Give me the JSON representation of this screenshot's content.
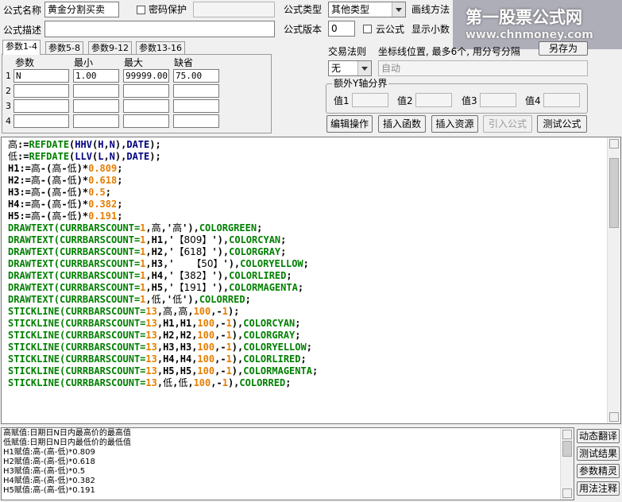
{
  "header": {
    "name_label": "公式名称",
    "name_value": "黄金分割买卖",
    "password_label": "密码保护",
    "desc_label": "公式描述",
    "desc_value": "",
    "type_label": "公式类型",
    "type_value": "其他类型",
    "draw_label": "画线方法",
    "version_label": "公式版本",
    "version_value": "0",
    "cloud_label": "云公式",
    "show_label": "显示小数"
  },
  "tabs": [
    "参数1-4",
    "参数5-8",
    "参数9-12",
    "参数13-16"
  ],
  "params": {
    "headers": [
      "参数",
      "最小",
      "最大",
      "缺省"
    ],
    "rows": [
      {
        "num": "1",
        "name": "N",
        "min": "1.00",
        "max": "99999.00",
        "default": "75.00"
      },
      {
        "num": "2",
        "name": "",
        "min": "",
        "max": "",
        "default": ""
      },
      {
        "num": "3",
        "name": "",
        "min": "",
        "max": "",
        "default": ""
      },
      {
        "num": "4",
        "name": "",
        "min": "",
        "max": "",
        "default": ""
      }
    ]
  },
  "right": {
    "trade_label": "交易法则",
    "trade_value": "无",
    "coord_label": "坐标线位置, 最多6个, 用分号分隔",
    "coord_value": "自动",
    "save_as": "另存为",
    "yaxis_label": "额外Y轴分界",
    "val_labels": [
      "值1",
      "值2",
      "值3",
      "值4"
    ]
  },
  "buttons": {
    "edit": "编辑操作",
    "insert_fn": "插入函数",
    "insert_res": "插入资源",
    "import": "引入公式",
    "test": "测试公式"
  },
  "code_lines": [
    [
      [
        "t",
        "高"
      ],
      [
        "o",
        ":="
      ],
      [
        "f",
        "REFDATE"
      ],
      [
        "o",
        "("
      ],
      [
        "k",
        "HHV"
      ],
      [
        "o",
        "("
      ],
      [
        "k",
        "H"
      ],
      [
        "o",
        ","
      ],
      [
        "k",
        "N"
      ],
      [
        "o",
        "),"
      ],
      [
        "k",
        "DATE"
      ],
      [
        "o",
        ");"
      ]
    ],
    [
      [
        "t",
        "低"
      ],
      [
        "o",
        ":="
      ],
      [
        "f",
        "REFDATE"
      ],
      [
        "o",
        "("
      ],
      [
        "k",
        "LLV"
      ],
      [
        "o",
        "("
      ],
      [
        "k",
        "L"
      ],
      [
        "o",
        ","
      ],
      [
        "k",
        "N"
      ],
      [
        "o",
        "),"
      ],
      [
        "k",
        "DATE"
      ],
      [
        "o",
        ");"
      ]
    ],
    [
      [
        "o",
        "H1:="
      ],
      [
        "t",
        "高"
      ],
      [
        "o",
        "-("
      ],
      [
        "t",
        "高"
      ],
      [
        "o",
        "-"
      ],
      [
        "t",
        "低"
      ],
      [
        "o",
        ")*"
      ],
      [
        "n",
        "0.809"
      ],
      [
        "o",
        ";"
      ]
    ],
    [
      [
        "o",
        "H2:="
      ],
      [
        "t",
        "高"
      ],
      [
        "o",
        "-("
      ],
      [
        "t",
        "高"
      ],
      [
        "o",
        "-"
      ],
      [
        "t",
        "低"
      ],
      [
        "o",
        ")*"
      ],
      [
        "n",
        "0.618"
      ],
      [
        "o",
        ";"
      ]
    ],
    [
      [
        "o",
        "H3:="
      ],
      [
        "t",
        "高"
      ],
      [
        "o",
        "-("
      ],
      [
        "t",
        "高"
      ],
      [
        "o",
        "-"
      ],
      [
        "t",
        "低"
      ],
      [
        "o",
        ")*"
      ],
      [
        "n",
        "0.5"
      ],
      [
        "o",
        ";"
      ]
    ],
    [
      [
        "o",
        "H4:="
      ],
      [
        "t",
        "高"
      ],
      [
        "o",
        "-("
      ],
      [
        "t",
        "高"
      ],
      [
        "o",
        "-"
      ],
      [
        "t",
        "低"
      ],
      [
        "o",
        ")*"
      ],
      [
        "n",
        "0.382"
      ],
      [
        "o",
        ";"
      ]
    ],
    [
      [
        "o",
        "H5:="
      ],
      [
        "t",
        "高"
      ],
      [
        "o",
        "-("
      ],
      [
        "t",
        "高"
      ],
      [
        "o",
        "-"
      ],
      [
        "t",
        "低"
      ],
      [
        "o",
        ")*"
      ],
      [
        "n",
        "0.191"
      ],
      [
        "o",
        ";"
      ]
    ],
    [
      [
        "f",
        "DRAWTEXT(CURRBARSCOUNT="
      ],
      [
        "n",
        "1"
      ],
      [
        "o",
        ","
      ],
      [
        "t",
        "高"
      ],
      [
        "o",
        ",'"
      ],
      [
        "t",
        "高"
      ],
      [
        "o",
        "'),"
      ],
      [
        "f",
        "COLORGREEN"
      ],
      [
        "o",
        ";"
      ]
    ],
    [
      [
        "f",
        "DRAWTEXT(CURRBARSCOUNT="
      ],
      [
        "n",
        "1"
      ],
      [
        "o",
        ",H1,'"
      ],
      [
        "t",
        "【809】"
      ],
      [
        "o",
        "'),"
      ],
      [
        "f",
        "COLORCYAN"
      ],
      [
        "o",
        ";"
      ]
    ],
    [
      [
        "f",
        "DRAWTEXT(CURRBARSCOUNT="
      ],
      [
        "n",
        "1"
      ],
      [
        "o",
        ",H2,'"
      ],
      [
        "t",
        "【618】"
      ],
      [
        "o",
        "'),"
      ],
      [
        "f",
        "COLORGRAY"
      ],
      [
        "o",
        ";"
      ]
    ],
    [
      [
        "f",
        "DRAWTEXT(CURRBARSCOUNT="
      ],
      [
        "n",
        "1"
      ],
      [
        "o",
        ",H3,'   "
      ],
      [
        "t",
        "【50】"
      ],
      [
        "o",
        "'),"
      ],
      [
        "f",
        "COLORYELLOW"
      ],
      [
        "o",
        ";"
      ]
    ],
    [
      [
        "f",
        "DRAWTEXT(CURRBARSCOUNT="
      ],
      [
        "n",
        "1"
      ],
      [
        "o",
        ",H4,'"
      ],
      [
        "t",
        "【382】"
      ],
      [
        "o",
        "'),"
      ],
      [
        "f",
        "COLORLIRED"
      ],
      [
        "o",
        ";"
      ]
    ],
    [
      [
        "f",
        "DRAWTEXT(CURRBARSCOUNT="
      ],
      [
        "n",
        "1"
      ],
      [
        "o",
        ",H5,'"
      ],
      [
        "t",
        "【191】"
      ],
      [
        "o",
        "'),"
      ],
      [
        "f",
        "COLORMAGENTA"
      ],
      [
        "o",
        ";"
      ]
    ],
    [
      [
        "f",
        "DRAWTEXT(CURRBARSCOUNT="
      ],
      [
        "n",
        "1"
      ],
      [
        "o",
        ","
      ],
      [
        "t",
        "低"
      ],
      [
        "o",
        ",'"
      ],
      [
        "t",
        "低"
      ],
      [
        "o",
        "'),"
      ],
      [
        "f",
        "COLORRED"
      ],
      [
        "o",
        ";"
      ]
    ],
    [
      [
        "f",
        "STICKLINE(CURRBARSCOUNT="
      ],
      [
        "n",
        "13"
      ],
      [
        "o",
        ","
      ],
      [
        "t",
        "高"
      ],
      [
        "o",
        ","
      ],
      [
        "t",
        "高"
      ],
      [
        "o",
        ","
      ],
      [
        "n",
        "100"
      ],
      [
        "o",
        ",-"
      ],
      [
        "n",
        "1"
      ],
      [
        "o",
        ");"
      ]
    ],
    [
      [
        "f",
        "STICKLINE(CURRBARSCOUNT="
      ],
      [
        "n",
        "13"
      ],
      [
        "o",
        ",H1,H1,"
      ],
      [
        "n",
        "100"
      ],
      [
        "o",
        ",-"
      ],
      [
        "n",
        "1"
      ],
      [
        "o",
        "),"
      ],
      [
        "f",
        "COLORCYAN"
      ],
      [
        "o",
        ";"
      ]
    ],
    [
      [
        "f",
        "STICKLINE(CURRBARSCOUNT="
      ],
      [
        "n",
        "13"
      ],
      [
        "o",
        ",H2,H2,"
      ],
      [
        "n",
        "100"
      ],
      [
        "o",
        ",-"
      ],
      [
        "n",
        "1"
      ],
      [
        "o",
        "),"
      ],
      [
        "f",
        "COLORGRAY"
      ],
      [
        "o",
        ";"
      ]
    ],
    [
      [
        "f",
        "STICKLINE(CURRBARSCOUNT="
      ],
      [
        "n",
        "13"
      ],
      [
        "o",
        ",H3,H3,"
      ],
      [
        "n",
        "100"
      ],
      [
        "o",
        ",-"
      ],
      [
        "n",
        "1"
      ],
      [
        "o",
        "),"
      ],
      [
        "f",
        "COLORYELLOW"
      ],
      [
        "o",
        ";"
      ]
    ],
    [
      [
        "f",
        "STICKLINE(CURRBARSCOUNT="
      ],
      [
        "n",
        "13"
      ],
      [
        "o",
        ",H4,H4,"
      ],
      [
        "n",
        "100"
      ],
      [
        "o",
        ",-"
      ],
      [
        "n",
        "1"
      ],
      [
        "o",
        "),"
      ],
      [
        "f",
        "COLORLIRED"
      ],
      [
        "o",
        ";"
      ]
    ],
    [
      [
        "f",
        "STICKLINE(CURRBARSCOUNT="
      ],
      [
        "n",
        "13"
      ],
      [
        "o",
        ",H5,H5,"
      ],
      [
        "n",
        "100"
      ],
      [
        "o",
        ",-"
      ],
      [
        "n",
        "1"
      ],
      [
        "o",
        "),"
      ],
      [
        "f",
        "COLORMAGENTA"
      ],
      [
        "o",
        ";"
      ]
    ],
    [
      [
        "f",
        "STICKLINE(CURRBARSCOUNT="
      ],
      [
        "n",
        "13"
      ],
      [
        "o",
        ","
      ],
      [
        "t",
        "低"
      ],
      [
        "o",
        ","
      ],
      [
        "t",
        "低"
      ],
      [
        "o",
        ","
      ],
      [
        "n",
        "100"
      ],
      [
        "o",
        ",-"
      ],
      [
        "n",
        "1"
      ],
      [
        "o",
        "),"
      ],
      [
        "f",
        "COLORRED"
      ],
      [
        "o",
        ";"
      ]
    ]
  ],
  "output_lines": [
    "高赋值:日期日N日内最高价的最高值",
    "低赋值:日期日N日内最低价的最低值",
    "H1赋值:高-(高-低)*0.809",
    "H2赋值:高-(高-低)*0.618",
    "H3赋值:高-(高-低)*0.5",
    "H4赋值:高-(高-低)*0.382",
    "H5赋值:高-(高-低)*0.191"
  ],
  "side_buttons": [
    "动态翻译",
    "测试结果",
    "参数精灵",
    "用法注释"
  ],
  "watermark": {
    "line1": "第一股票公式网",
    "line2": "www.chnmoney.com"
  }
}
